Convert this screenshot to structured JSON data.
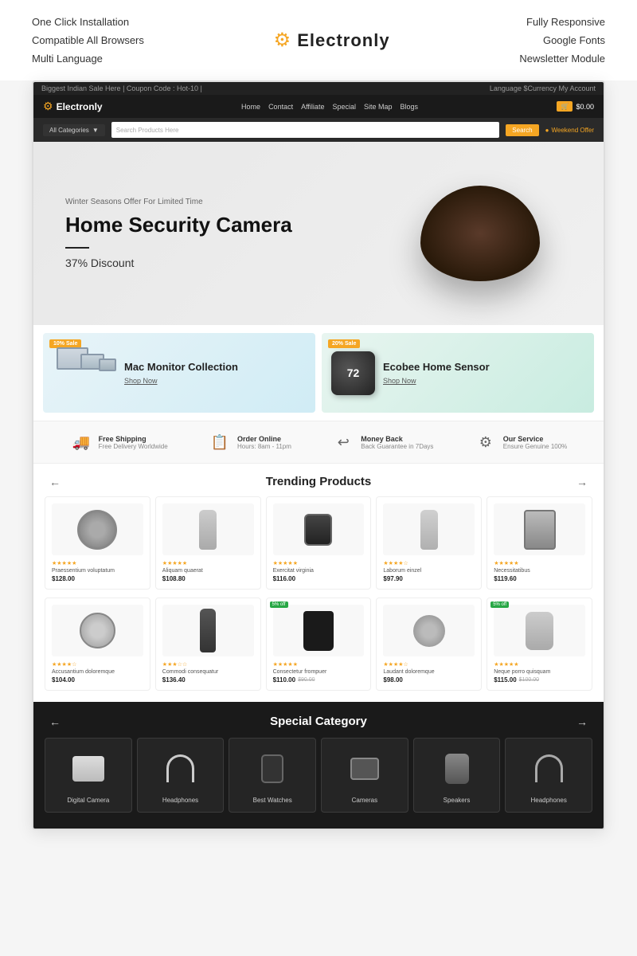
{
  "top": {
    "features_left": [
      "One Click Installation",
      "Compatible All Browsers",
      "Multi Language"
    ],
    "features_right": [
      "Fully Responsive",
      "Google Fonts",
      "Newsletter Module"
    ],
    "logo": "Electronly",
    "logo_icon": "⚙"
  },
  "site": {
    "topbar_text": "Biggest Indian Sale Here | Coupon Code : Hot-10 |",
    "topbar_right": "Language  $Currency  My Account",
    "nav_links": [
      "Home",
      "Contact",
      "Affiliate",
      "Special",
      "Site Map",
      "Blogs"
    ],
    "cart_text": "$0.00",
    "categories_label": "All Categories",
    "search_placeholder": "Search Products Here",
    "search_btn": "Search",
    "weekend_offer": "Weekend Offer",
    "hero": {
      "subtitle": "Winter Seasons Offer For Limited Time",
      "title": "Home Security Camera",
      "discount": "37% Discount"
    },
    "promo_1": {
      "badge": "10% Sale",
      "title": "Mac Monitor Collection",
      "link": "Shop Now"
    },
    "promo_2": {
      "badge": "20% Sale",
      "title": "Ecobee Home Sensor",
      "link": "Shop Now"
    },
    "features": [
      {
        "icon": "🚚",
        "title": "Free Shipping",
        "sub": "Free Delivery Worldwide"
      },
      {
        "icon": "📋",
        "title": "Order Online",
        "sub": "Hours: 8am - 11pm"
      },
      {
        "icon": "↩",
        "title": "Money Back",
        "sub": "Back Guarantee in 7Days"
      },
      {
        "icon": "⚙",
        "title": "Our Service",
        "sub": "Ensure Genuine 100%"
      }
    ],
    "trending_title": "Trending Products",
    "products_row1": [
      {
        "name": "Praessentium voluptatum",
        "price": "$128.00",
        "stars": "★★★★★",
        "badge": ""
      },
      {
        "name": "Aliquam quaerat",
        "price": "$108.80",
        "stars": "★★★★★",
        "badge": ""
      },
      {
        "name": "Exercitat virginia",
        "price": "$116.00",
        "stars": "★★★★★",
        "badge": ""
      },
      {
        "name": "Laborum einzel",
        "price": "$97.90",
        "stars": "★★★★☆",
        "badge": ""
      },
      {
        "name": "Necessitatibus",
        "price": "$119.60",
        "stars": "★★★★★",
        "badge": ""
      }
    ],
    "products_row2": [
      {
        "name": "Accusantium doloremque",
        "price": "$104.00",
        "price_old": "",
        "stars": "★★★★☆",
        "badge": ""
      },
      {
        "name": "Commodi consequatur",
        "price": "$136.40",
        "price_old": "",
        "stars": "★★★☆☆",
        "badge": ""
      },
      {
        "name": "Consectetur frompuer",
        "price": "$110.00",
        "price_old": "$90.00",
        "stars": "★★★★★",
        "badge": "5% off"
      },
      {
        "name": "Laudant doloremque",
        "price": "$98.00",
        "price_old": "",
        "stars": "★★★★☆",
        "badge": ""
      },
      {
        "name": "Neque porro quisquam",
        "price": "$115.00",
        "price_old": "$100.00",
        "stars": "★★★★★",
        "badge": "5% off"
      }
    ],
    "special_title": "Special Category",
    "categories": [
      "Digital Camera",
      "Headphones",
      "Best Watches",
      "Cameras",
      "Speakers",
      "Headphones"
    ]
  }
}
